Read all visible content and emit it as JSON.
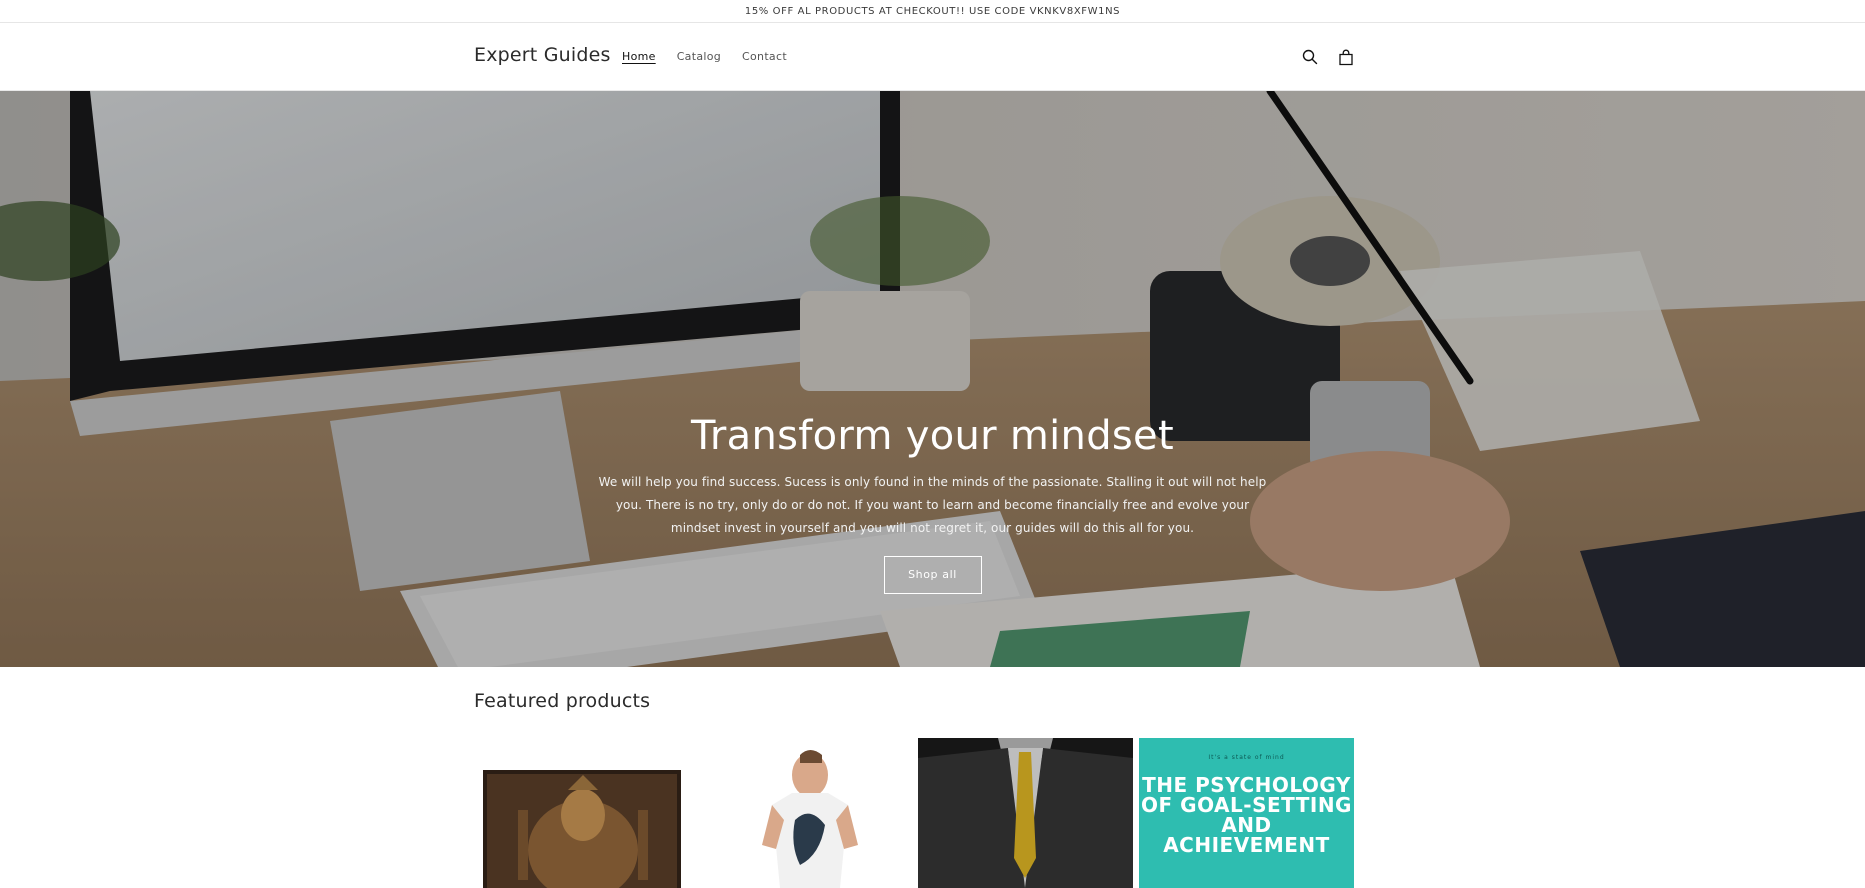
{
  "announcement": {
    "text": "15% OFF AL PRODUCTS AT CHECKOUT!! USE CODE VKNKV8XFW1NS"
  },
  "header": {
    "logo": "Expert Guides",
    "nav": [
      {
        "label": "Home",
        "active": true
      },
      {
        "label": "Catalog",
        "active": false
      },
      {
        "label": "Contact",
        "active": false
      }
    ],
    "icons": [
      "search-icon",
      "cart-icon"
    ]
  },
  "hero": {
    "title": "Transform your mindset",
    "text": "We will help you find success. Sucess is only found in the minds of the passionate. Stalling it out will not help you. There is no try, only do or do not. If you want to learn and become financially free and evolve your mindset invest in yourself and you will not regret it, our guides will do this all for you.",
    "button": "Shop all"
  },
  "featured": {
    "title": "Featured products",
    "products": [
      {
        "image": "armored-knight-painting"
      },
      {
        "image": "man-in-white-tshirt"
      },
      {
        "image": "suit-with-gold-tie"
      },
      {
        "image": "psychology-book-cover",
        "tagline": "It's a state of mind",
        "cover_title": "THE PSYCHOLOGY OF GOAL-SETTING AND ACHIEVEMENT"
      }
    ]
  },
  "colors": {
    "book_cover": "#2ebdb0",
    "text": "#121212"
  }
}
